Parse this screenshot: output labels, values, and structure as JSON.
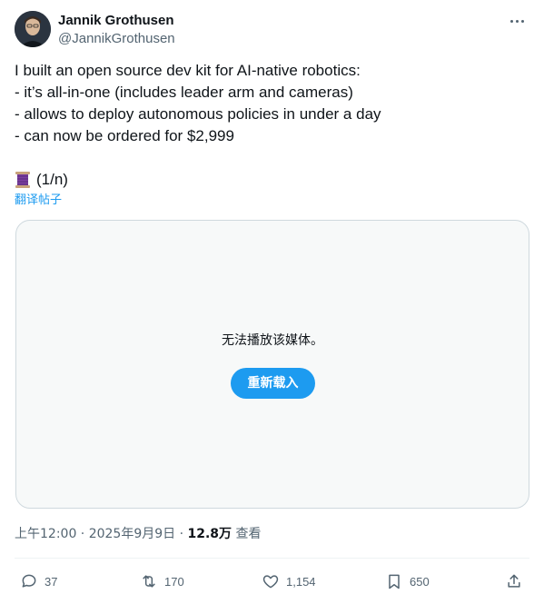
{
  "author": {
    "display_name": "Jannik Grothusen",
    "handle": "@JannikGrothusen"
  },
  "post": {
    "lines": [
      "I built an open source dev kit for AI-native robotics:",
      "- it’s all-in-one (includes leader arm and cameras)",
      "- allows to deploy autonomous policies in under a day",
      "- can now be ordered for $2,999"
    ],
    "thread_marker": "(1/n)",
    "thread_icon": "spool-of-thread-emoji",
    "translate_label": "翻译帖子"
  },
  "media": {
    "error_text": "无法播放该媒体。",
    "reload_label": "重新载入"
  },
  "meta": {
    "timestamp": "上午12:00 · 2025年9月9日 · ",
    "views_count": "12.8万",
    "views_label": " 查看"
  },
  "actions": {
    "replies": "37",
    "reposts": "170",
    "likes": "1,154",
    "bookmarks": "650"
  },
  "colors": {
    "accent": "#1d9bf0",
    "text_primary": "#0f1419",
    "text_secondary": "#536471",
    "media_bg": "#f7f9f9",
    "border": "#cfd9de"
  }
}
